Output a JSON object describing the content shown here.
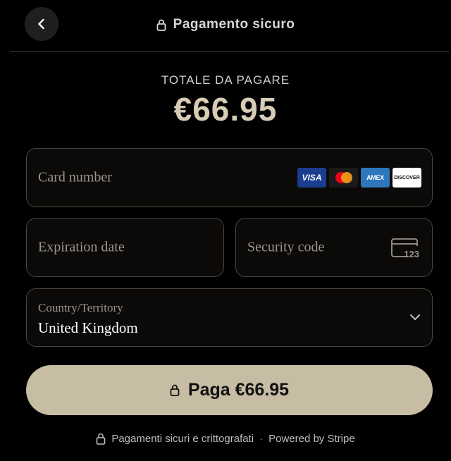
{
  "header": {
    "title": "Pagamento sicuro",
    "back_icon": "chevron-left-icon",
    "lock_icon": "lock-icon"
  },
  "summary": {
    "label": "TOTALE DA PAGARE",
    "amount": "€66.95"
  },
  "form": {
    "card_number": {
      "placeholder": "Card number",
      "value": ""
    },
    "card_brands": [
      "VISA",
      "Mastercard",
      "AMEX",
      "DISCOVER"
    ],
    "expiration": {
      "placeholder": "Expiration date",
      "value": ""
    },
    "security_code": {
      "placeholder": "Security code",
      "value": "",
      "icon_text": "123"
    },
    "country": {
      "label": "Country/Territory",
      "value": "United Kingdom"
    }
  },
  "pay_button": {
    "label": "Paga €66.95"
  },
  "footer": {
    "secure_text": "Pagamenti sicuri e crittografati",
    "separator": "·",
    "powered_by": "Powered by Stripe"
  },
  "colors": {
    "background": "#000000",
    "accent": "#c7bca4",
    "amount": "#d8ccb6",
    "field_border": "#4a4640"
  }
}
